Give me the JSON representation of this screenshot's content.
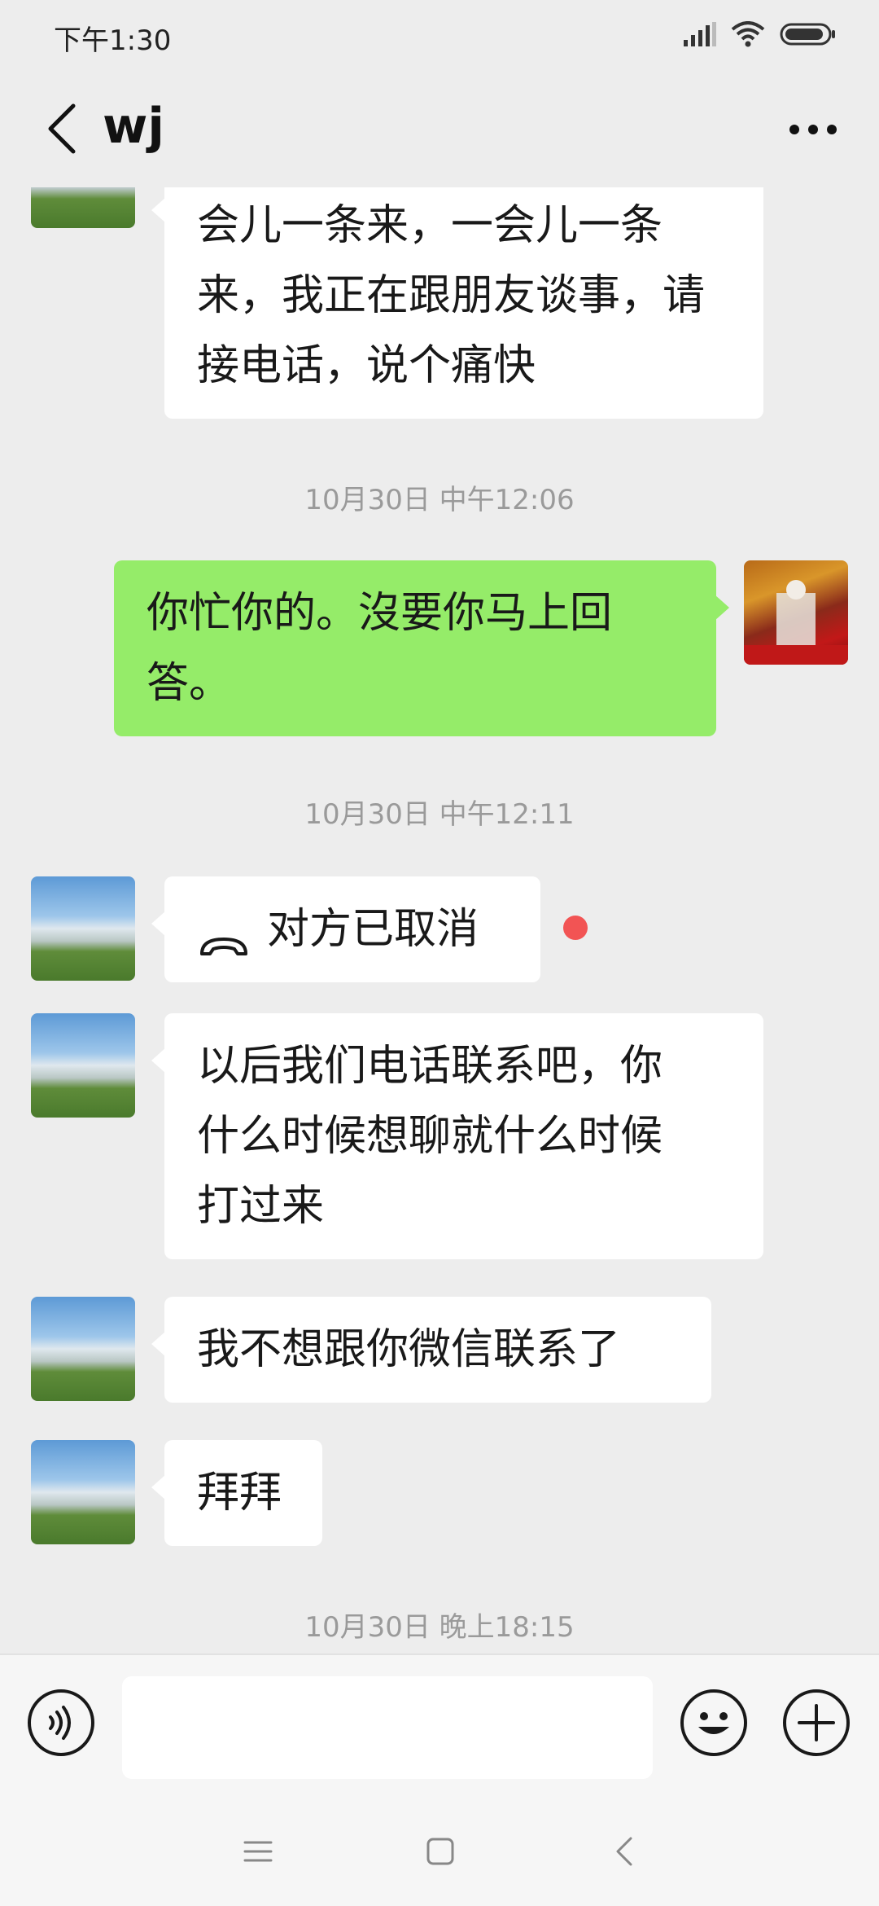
{
  "status": {
    "time": "下午1:30",
    "icons": [
      "signal-icon",
      "wifi-icon",
      "battery-icon"
    ]
  },
  "header": {
    "title": "wj",
    "back_icon": "chevron-left-icon",
    "more_icon": "more-dots-icon"
  },
  "messages": [
    {
      "type": "text",
      "from": "other",
      "avatar": "building",
      "lines": [
        "会儿一条来，一会儿一条",
        "来，我正在跟朋友谈事，请",
        "接电话，说个痛快"
      ]
    },
    {
      "type": "timestamp",
      "text": "10月30日 中午12:06"
    },
    {
      "type": "text",
      "from": "self",
      "avatar": "red-garden",
      "lines": [
        "你忙你的。沒要你马上回",
        "答。"
      ]
    },
    {
      "type": "timestamp",
      "text": "10月30日 中午12:11"
    },
    {
      "type": "call",
      "from": "other",
      "avatar": "building",
      "icon": "phone-hangup-icon",
      "text": "对方已取消",
      "unread": true
    },
    {
      "type": "text",
      "from": "other",
      "avatar": "building",
      "lines": [
        "以后我们电话联系吧，你",
        "什么时候想聊就什么时候",
        "打过来"
      ]
    },
    {
      "type": "text",
      "from": "other",
      "avatar": "building",
      "lines": [
        "我不想跟你微信联系了"
      ]
    },
    {
      "type": "text",
      "from": "other",
      "avatar": "building",
      "lines": [
        "拜拜"
      ]
    },
    {
      "type": "timestamp",
      "text": "10月30日 晚上18:15"
    }
  ],
  "input_bar": {
    "voice_icon": "voice-icon",
    "text_value": "",
    "emoji_icon": "emoji-icon",
    "plus_icon": "plus-icon"
  },
  "nav": {
    "menu_icon": "menu-icon",
    "home_icon": "home-square-icon",
    "back_icon": "back-triangle-icon"
  },
  "colors": {
    "background": "#ededed",
    "self_bubble": "#95ec69",
    "other_bubble": "#ffffff",
    "unread_dot": "#f25454",
    "timestamp": "#9a9a9a"
  }
}
